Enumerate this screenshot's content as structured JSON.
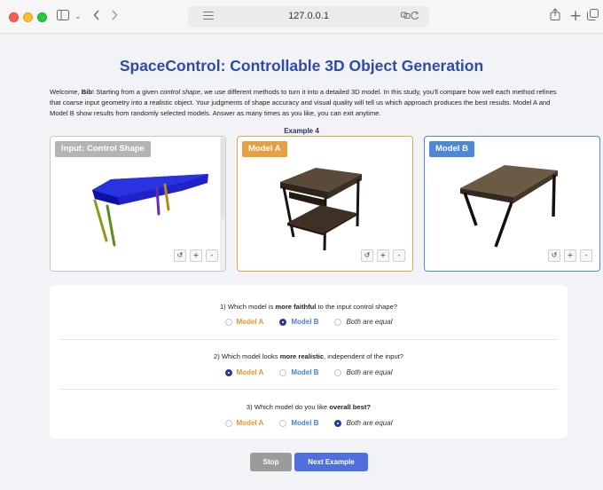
{
  "browser": {
    "url": "127.0.0.1",
    "icons": {
      "sidebar": "sidebar-icon",
      "chevron": "chevron-down-icon",
      "back": "back-icon",
      "forward": "forward-icon",
      "share": "share-icon",
      "new_tab": "plus-icon",
      "tabs": "tab-overview-icon",
      "reload": "reload-icon"
    }
  },
  "page": {
    "title": "SpaceControl: Controllable 3D Object Generation",
    "intro": {
      "p1": "Welcome, ",
      "user": "Bib",
      "p2": "! Starting from a given ",
      "control_shape": "control shape",
      "p3": ", we use different methods to turn it into a detailed 3D model. In this study, you'll compare how well each method refines that coarse input geometry into a realistic object. Your judgments of shape accuracy and visual quality will tell us which approach produces the best results. Model A and Model B show results from randomly selected models. Answer as many times as you like, you can exit anytime."
    },
    "example_label": "Example 4"
  },
  "panels": [
    {
      "label": "Input: Control Shape",
      "controls": [
        "↺",
        "+",
        "-"
      ]
    },
    {
      "label": "Model A",
      "controls": [
        "↺",
        "+",
        "-"
      ]
    },
    {
      "label": "Model B",
      "controls": [
        "↺",
        "+",
        "-"
      ]
    }
  ],
  "options": {
    "a": "Model A",
    "b": "Model B",
    "equal": "Both are equal"
  },
  "questions": [
    {
      "pre": "1) Which model is ",
      "bold": "more faithful",
      "post": " to the input control shape?",
      "selected": "b"
    },
    {
      "pre": "2) Which model looks ",
      "bold": "more realistic",
      "post": ", independent of the input?",
      "selected": "a"
    },
    {
      "pre": "3) Which model do you like ",
      "bold": "overall best?",
      "post": "",
      "selected": "equal"
    }
  ],
  "buttons": {
    "stop": "Stop",
    "next": "Next Example"
  },
  "colors": {
    "title": "#2f4aa8",
    "model_a": "#e6a040",
    "model_b": "#4e87d6",
    "input": "#b4b4b4",
    "next_button": "#4f6fdc",
    "stop_button": "#9b9b9b",
    "radio_selected": "#2c3a8e"
  }
}
